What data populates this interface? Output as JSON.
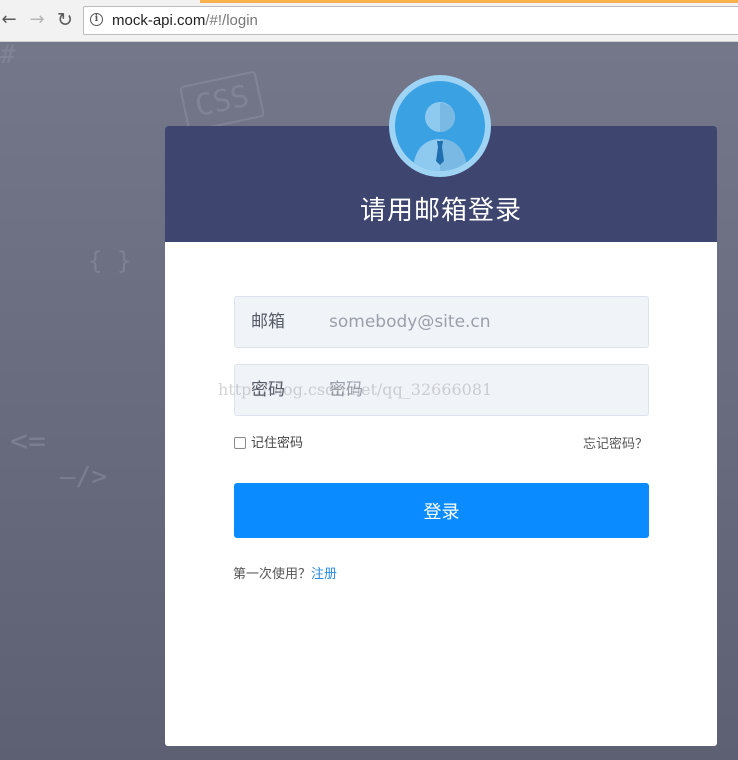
{
  "browser": {
    "url_host": "mock-api.com",
    "url_path": "/#!/login",
    "back_glyph": "←",
    "forward_glyph": "→",
    "reload_glyph": "↻",
    "info_glyph": "i"
  },
  "background": {
    "deco_hash": "#",
    "deco_css": "CSS",
    "deco_braces": "{ }",
    "deco_tag": "<=",
    "deco_close": "—/>"
  },
  "login": {
    "title": "请用邮箱登录",
    "email_label": "邮箱",
    "email_placeholder": "somebody@site.cn",
    "email_value": "",
    "password_label": "密码",
    "password_placeholder": "密码",
    "password_value": "",
    "remember_label": "记住密码",
    "remember_checked": false,
    "forgot_label": "忘记密码？",
    "submit_label": "登录",
    "first_use_text": "第一次使用？",
    "register_label": "注册"
  },
  "watermark": "http://blog.csdn.net/qq_32666081",
  "colors": {
    "header_bg": "#3e4670",
    "button_bg": "#0a8bff",
    "link": "#2a8ae6",
    "avatar_ring": "#9fd4f5",
    "avatar_fill": "#3aa1e3"
  },
  "icons": {
    "avatar": "user-avatar-icon",
    "info": "info-icon"
  }
}
